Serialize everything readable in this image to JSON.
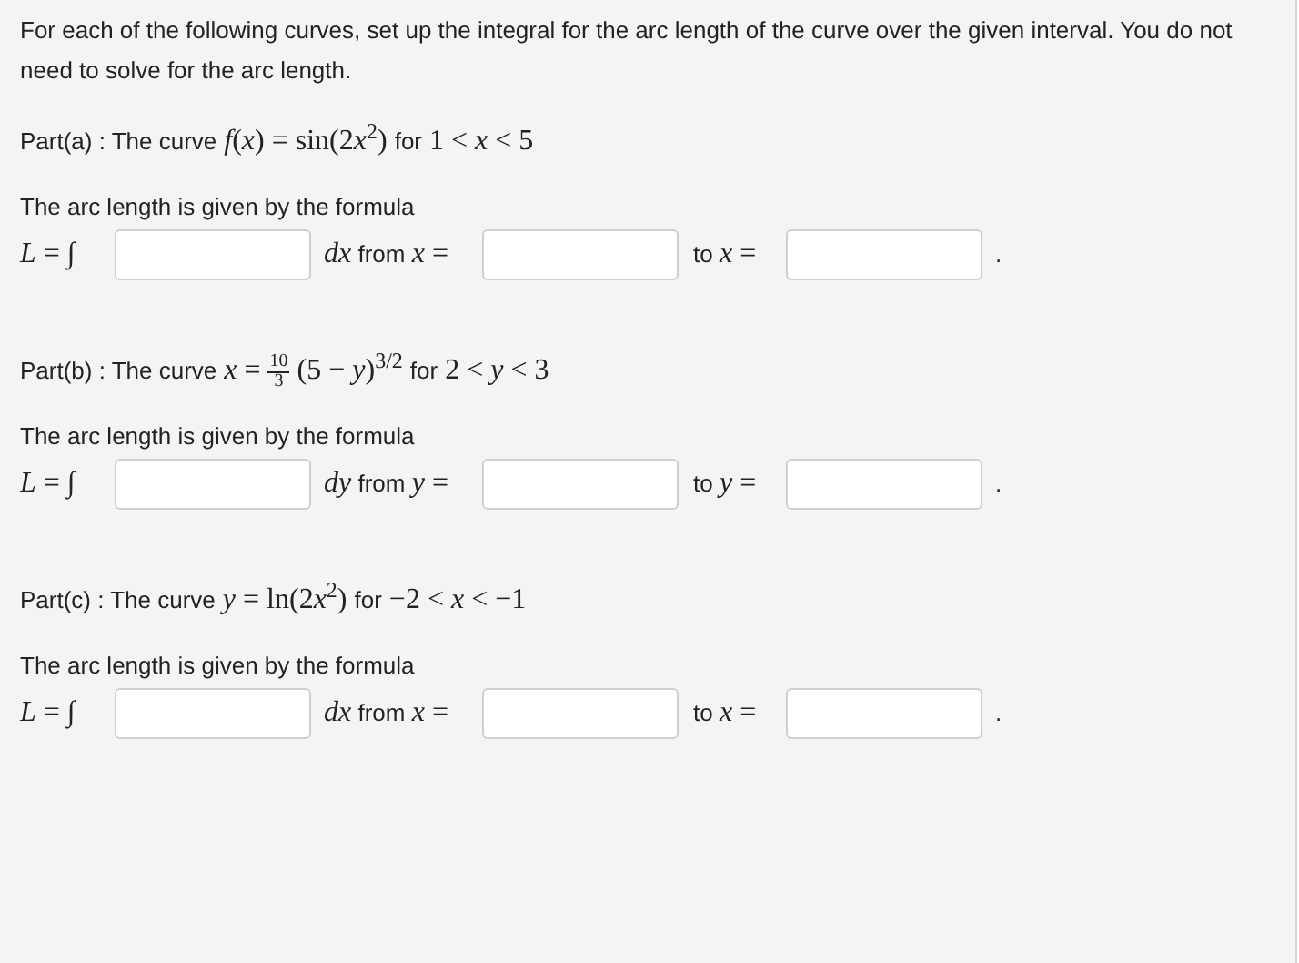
{
  "instructions": "For each of the following curves, set up the integral for the arc length of the curve over the given interval. You do not need to solve for the arc length.",
  "parts": [
    {
      "question": [
        {
          "kind": "text",
          "text": "Part(a) : The curve"
        },
        {
          "kind": "math",
          "text": "*f*(*x*) = sin(2"
        },
        {
          "kind": "math",
          "text": "*x*$^{2}$)",
          "join": true
        },
        {
          "kind": "text",
          "text": "for"
        },
        {
          "kind": "math",
          "text": "1 < *x* < 5"
        }
      ],
      "formula_label": "The arc length is given by the formula",
      "integral": "*L* = ∫",
      "differential": "*dx*",
      "from_text": "from",
      "from_var": "*x* =",
      "to_text": "to",
      "to_var": "*x* =",
      "end": "."
    },
    {
      "question": [
        {
          "kind": "text",
          "text": "Part(b) : The curve"
        },
        {
          "kind": "math",
          "text": "*x* ="
        },
        {
          "kind": "frac",
          "num": "10",
          "den": "3"
        },
        {
          "kind": "math",
          "text": "(5 − *y*)$^{3/2}$"
        },
        {
          "kind": "text",
          "text": "for"
        },
        {
          "kind": "math",
          "text": "2 < *y* < 3"
        }
      ],
      "formula_label": "The arc length is given by the formula",
      "integral": "*L* = ∫",
      "differential": "*dy*",
      "from_text": "from",
      "from_var": "*y* =",
      "to_text": "to",
      "to_var": "*y* =",
      "end": "."
    },
    {
      "question": [
        {
          "kind": "text",
          "text": "Part(c) : The curve"
        },
        {
          "kind": "math",
          "text": "*y* = ln(2"
        },
        {
          "kind": "math",
          "text": "*x*$^{2}$)",
          "join": true
        },
        {
          "kind": "text",
          "text": "for"
        },
        {
          "kind": "math",
          "text": "−2 < *x* < −1"
        }
      ],
      "formula_label": "The arc length is given by the formula",
      "integral": "*L* = ∫",
      "differential": "*dx*",
      "from_text": "from",
      "from_var": "*x* =",
      "to_text": "to",
      "to_var": "*x* =",
      "end": "."
    }
  ]
}
